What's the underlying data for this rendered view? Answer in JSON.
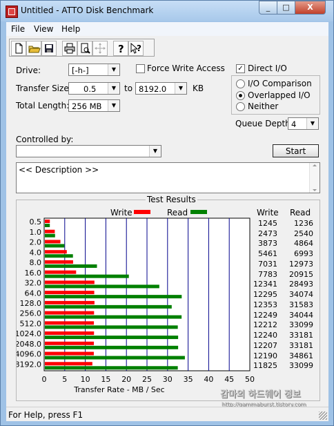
{
  "window": {
    "title": "Untitled - ATTO Disk Benchmark",
    "caption_min": "_",
    "caption_max": "□",
    "caption_close": "X"
  },
  "menu": [
    "File",
    "View",
    "Help"
  ],
  "toolbar_icons": [
    "new-document-icon",
    "open-folder-icon",
    "save-icon",
    "print-icon",
    "print-preview-icon",
    "move-icon",
    "help-icon",
    "context-help-icon"
  ],
  "form": {
    "drive_label": "Drive:",
    "drive_value": "[-h-]",
    "force_write_label": "Force Write Access",
    "force_write_checked": false,
    "direct_io_label": "Direct I/O",
    "direct_io_checked": true,
    "transfer_size_label": "Transfer Size:",
    "transfer_from": "0.5",
    "to_label": "to",
    "transfer_to": "8192.0",
    "kb_label": "KB",
    "total_length_label": "Total Length:",
    "total_length_value": "256 MB",
    "radio_options": [
      "I/O Comparison",
      "Overlapped I/O",
      "Neither"
    ],
    "radio_selected": "Overlapped I/O",
    "queue_depth_label": "Queue Depth:",
    "queue_depth_value": "4",
    "controlled_by_label": "Controlled by:",
    "controlled_by_value": "",
    "start_label": "Start",
    "description_text": "<< Description >>"
  },
  "results": {
    "title": "Test Results",
    "legend_write": "Write",
    "legend_read": "Read",
    "col_write": "Write",
    "col_read": "Read",
    "write_color": "#ff0000",
    "read_color": "#008000"
  },
  "chart_data": {
    "type": "bar",
    "orientation": "horizontal",
    "categories": [
      "0.5",
      "1.0",
      "2.0",
      "4.0",
      "8.0",
      "16.0",
      "32.0",
      "64.0",
      "128.0",
      "256.0",
      "512.0",
      "1024.0",
      "2048.0",
      "4096.0",
      "8192.0"
    ],
    "series": [
      {
        "name": "Write",
        "values": [
          1245,
          2473,
          3873,
          5461,
          7031,
          7783,
          12341,
          12295,
          12353,
          12249,
          12212,
          12240,
          12207,
          12190,
          11825
        ]
      },
      {
        "name": "Read",
        "values": [
          1236,
          2540,
          4864,
          6993,
          12973,
          20915,
          28493,
          34074,
          31583,
          34044,
          33099,
          33181,
          33181,
          34861,
          33099
        ]
      }
    ],
    "xlabel": "Transfer Rate - MB / Sec",
    "xticks": [
      "0",
      "5",
      "10",
      "15",
      "20",
      "25",
      "30",
      "35",
      "40",
      "45",
      "50"
    ],
    "xlim": [
      0,
      50
    ]
  },
  "status": {
    "text": "For Help, press F1"
  },
  "watermark": {
    "line1": "감마의 하드웨어 정보",
    "line2": "http://gammaburst.tistory.com"
  }
}
